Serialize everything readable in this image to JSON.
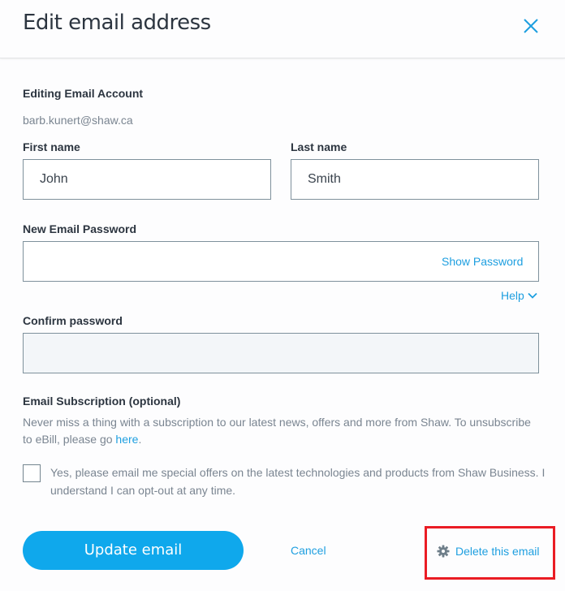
{
  "header": {
    "title": "Edit email address",
    "close_icon": "close-x-icon"
  },
  "account": {
    "label": "Editing Email Account",
    "email": "barb.kunert@shaw.ca"
  },
  "first_name": {
    "label": "First name",
    "value": "John"
  },
  "last_name": {
    "label": "Last name",
    "value": "Smith"
  },
  "new_password": {
    "label": "New Email Password",
    "value": "",
    "show_password_label": "Show Password"
  },
  "help": {
    "label": "Help",
    "icon": "chevron-down-icon"
  },
  "confirm_password": {
    "label": "Confirm password",
    "value": "",
    "disabled": true
  },
  "subscription": {
    "label": "Email Subscription (optional)",
    "description": "Never miss a thing with a subscription to our latest news, offers and more from Shaw. To unsubscribe to eBill, please go ",
    "link_text": "here",
    "description_end": ".",
    "checkbox_checked": false,
    "checkbox_label": "Yes, please email me special offers on the latest technologies and products from Shaw Business. I understand I can opt-out at any time."
  },
  "actions": {
    "update_label": "Update email",
    "cancel_label": "Cancel",
    "delete_label": "Delete this email",
    "delete_icon": "gear-icon"
  },
  "colors": {
    "accent": "#0fa8ec",
    "link": "#1e9fe0",
    "highlight_box": "#ea1c24"
  }
}
